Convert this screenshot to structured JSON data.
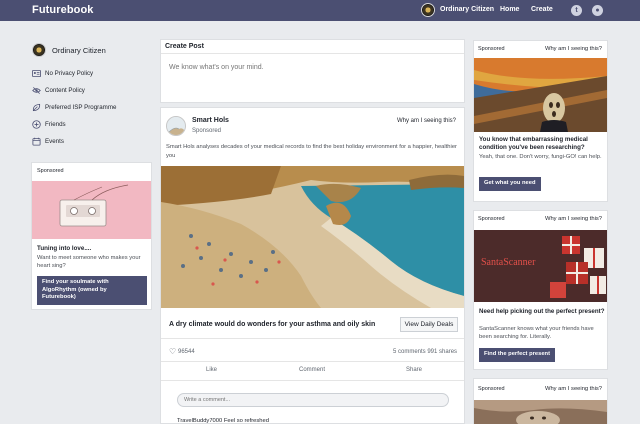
{
  "topbar": {
    "brand": "Futurebook",
    "user_name": "Ordinary Citizen",
    "home_label": "Home",
    "create_label": "Create",
    "icons": [
      "twitter-icon",
      "github-icon"
    ]
  },
  "sidebar": {
    "user_name": "Ordinary Citizen",
    "items": [
      {
        "label": "No Privacy Policy",
        "icon": "id-card-icon"
      },
      {
        "label": "Content Policy",
        "icon": "eye-slash-icon"
      },
      {
        "label": "Preferred ISP Programme",
        "icon": "leaf-icon"
      },
      {
        "label": "Friends",
        "icon": "plus-circle-icon"
      },
      {
        "label": "Events",
        "icon": "calendar-icon"
      }
    ]
  },
  "left_ad": {
    "label": "Sponsored",
    "title": "Tuning into love....",
    "text": "Want to meet someone who makes your heart sing?",
    "button": "Find your soulmate with AlgoRhythm (owned by Futurebook)"
  },
  "create_post": {
    "title": "Create Post",
    "placeholder": "We know what's on your mind."
  },
  "post": {
    "author": "Smart Hols",
    "sponsored": "Sponsored",
    "why": "Why am I seeing this?",
    "text": "Smart Hols analyses decades of your medical records to find the best holiday environment for a happier, healthier you",
    "headline": "A dry climate would do wonders for your asthma and oily skin",
    "cta": "View Daily Deals",
    "likes": "96544",
    "comments": "5 comments 991 shares",
    "actions": [
      "Like",
      "Comment",
      "Share"
    ],
    "comment_placeholder": "Write a comment...",
    "comment_peek": "TravelBuddy7000 Feel so refreshed"
  },
  "right_ads": [
    {
      "label": "Sponsored",
      "why": "Why am I seeing this?",
      "title": "You know that embarrassing medical condition you've been researching?",
      "text": "Yeah, that one. Don't worry, fungi-GO! can help.",
      "button": "Get what you need"
    },
    {
      "label": "Sponsored",
      "why": "Why am I seeing this?",
      "image_text": "SantaScanner",
      "title": "Need help picking out the perfect present?",
      "text": "SantaScanner knows what your friends have been searching for. Literally.",
      "button": "Find the perfect present"
    },
    {
      "label": "Sponsored",
      "why": "Why am I seeing this?"
    }
  ],
  "colors": {
    "topbar": "#4b4f72",
    "background": "#e9ebee",
    "button": "#4b4f72"
  }
}
